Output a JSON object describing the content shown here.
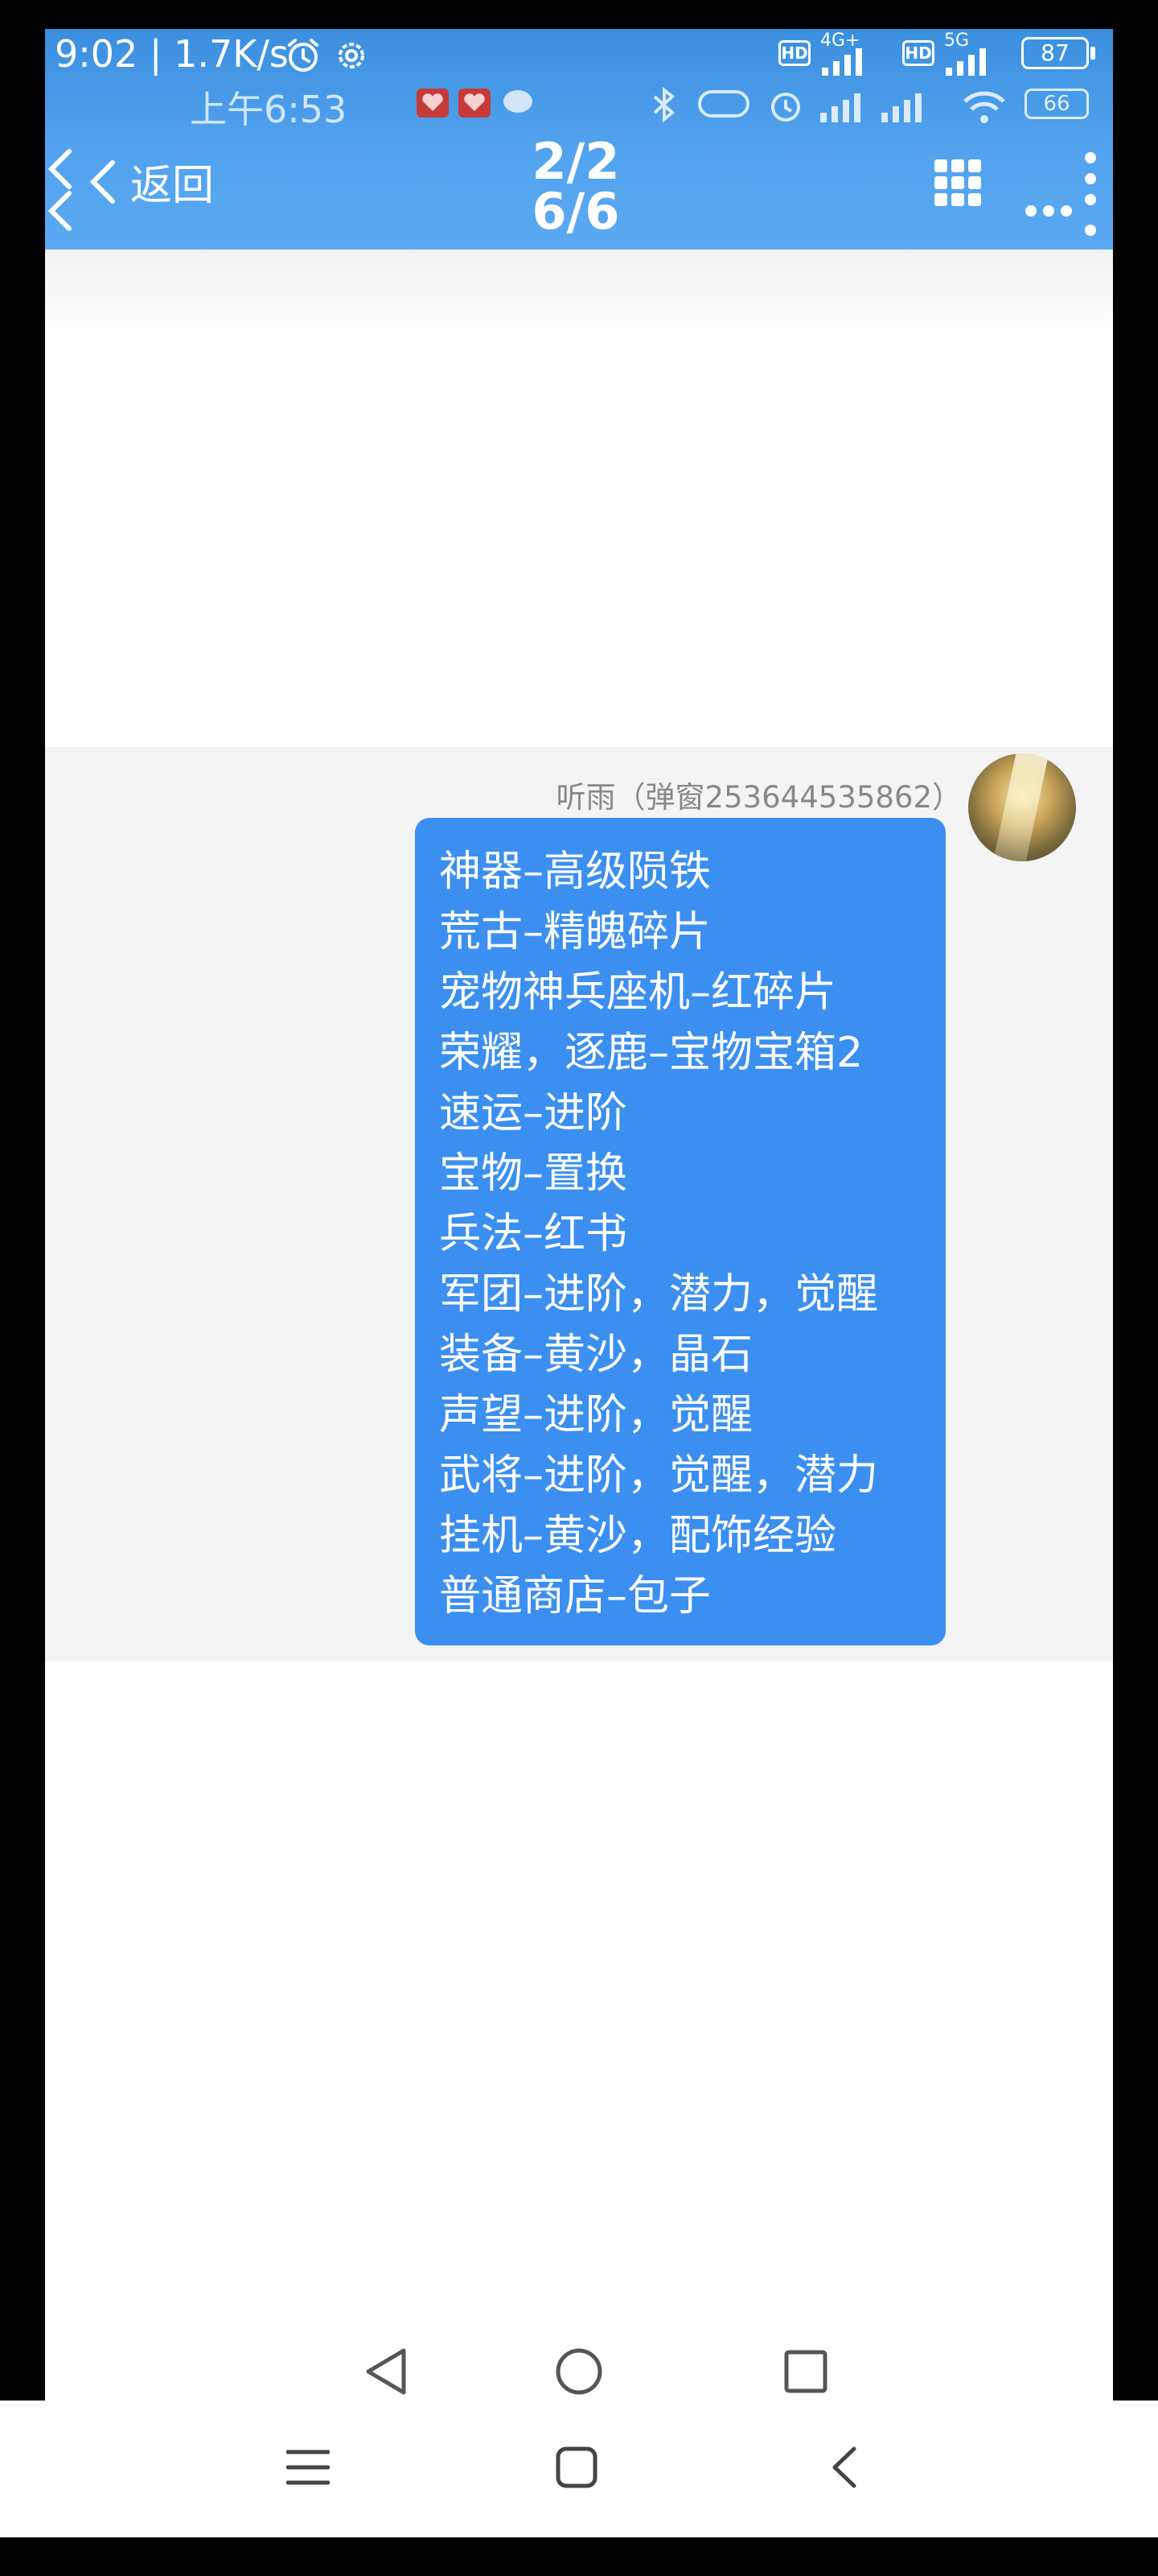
{
  "status_bar": {
    "time": "9:02",
    "speed": "1.7K/s",
    "battery": "87",
    "network_1": "4G+",
    "network_2": "5G",
    "hd_label": "HD"
  },
  "ghost_status_bar": {
    "time": "上午6:53",
    "battery": "66"
  },
  "header": {
    "back_label": "返回",
    "counter_primary": "2/2",
    "counter_secondary": "6/6"
  },
  "message": {
    "sender": "听雨（弹窗253644535862）",
    "lines": [
      "神器–高级陨铁",
      "荒古–精魄碎片",
      "宠物神兵座机–红碎片",
      "荣耀，逐鹿–宝物宝箱2",
      "速运–进阶",
      "宝物–置换",
      "兵法–红书",
      "军团–进阶，潜力，觉醒",
      "装备–黄沙，晶石",
      "声望–进阶，觉醒",
      "武将–进阶，觉醒，潜力",
      "挂机–黄沙，配饰经验",
      "普通商店–包子"
    ],
    "bubble_color": "#3b8ff0"
  },
  "colors": {
    "header_blue": "#52a3ef",
    "bubble_blue": "#3b8ff0"
  },
  "icons": {
    "back": "chevron-left-icon",
    "grid": "grid-icon",
    "more": "more-icon",
    "nav_back": "triangle-back-icon",
    "nav_home": "circle-home-icon",
    "nav_recent": "square-recent-icon",
    "menu": "menu-icon",
    "home": "home-icon",
    "return": "return-icon"
  }
}
